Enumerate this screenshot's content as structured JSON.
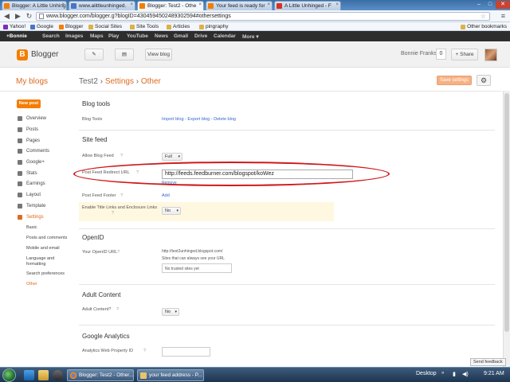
{
  "browser": {
    "tabs": [
      {
        "title": "Blogger: A Little Unhing"
      },
      {
        "title": "www.alittleunhinged."
      },
      {
        "title": "Blogger: Test2 - Othe"
      },
      {
        "title": "Your feed is ready for"
      },
      {
        "title": "A Little Unhinged - F"
      }
    ],
    "url": "www.blogger.com/blogger.g?blogID=4304594502489302594#othersettings",
    "bookmarks": [
      "Yahoo!",
      "Google",
      "Blogger",
      "Social Sites",
      "Site Tools",
      "Articles",
      "pingraphy"
    ],
    "other_bookmarks": "Other bookmarks"
  },
  "google_bar": [
    "+Bonnie",
    "Search",
    "Images",
    "Maps",
    "Play",
    "YouTube",
    "News",
    "Gmail",
    "Drive",
    "Calendar",
    "More ▾"
  ],
  "header": {
    "brand": "Blogger",
    "view_blog": "View blog",
    "user_name": "Bonnie Franks",
    "notifications": "0",
    "share": "+ Share"
  },
  "subheader": {
    "my_blogs": "My blogs",
    "blog_name": "Test2",
    "crumb_sep": "›",
    "settings": "Settings",
    "other": "Other",
    "save_button": "Save settings"
  },
  "sidebar": {
    "new_post": "New post",
    "items": [
      "Overview",
      "Posts",
      "Pages",
      "Comments",
      "Google+",
      "Stats",
      "Earnings",
      "Layout",
      "Template",
      "Settings"
    ],
    "subitems": [
      "Basic",
      "Posts and comments",
      "Mobile and email",
      "Language and formatting",
      "Search preferences",
      "Other"
    ]
  },
  "main": {
    "blog_tools": {
      "title": "Blog tools",
      "label": "Blog Tools",
      "import": "Import blog",
      "export": "Export blog",
      "delete": "Delete blog",
      "sep": " - "
    },
    "site_feed": {
      "title": "Site feed",
      "allow_label": "Allow Blog Feed",
      "allow_value": "Full",
      "redirect_label": "Post Feed Redirect URL",
      "redirect_value": "http://feeds.feedburner.com/blogspot/koWez",
      "remove": "Remove",
      "footer_label": "Post Feed Footer",
      "footer_add": "Add",
      "enclosure_label": "Enable Title Links and Enclosure Links",
      "enclosure_value": "No"
    },
    "openid": {
      "title": "OpenID",
      "label": "Your OpenID URL",
      "url": "http://test2unhinged.blogspot.com/",
      "note": "Sites that can always see your URL",
      "trusted": "No trusted sites yet"
    },
    "adult": {
      "title": "Adult Content",
      "label": "Adult Content?",
      "value": "No"
    },
    "analytics": {
      "title": "Google Analytics",
      "label": "Analytics Web Property ID"
    },
    "help_mark": "?"
  },
  "send_feedback": "Send feedback",
  "taskbar": {
    "tasks": [
      "Blogger: Test2 - Other...",
      "your feed address - P..."
    ],
    "desktop": "Desktop",
    "time": "9:21 AM"
  },
  "colors": {
    "accent": "#f57d00",
    "link": "#3366cc",
    "annotation": "#d0191b"
  }
}
